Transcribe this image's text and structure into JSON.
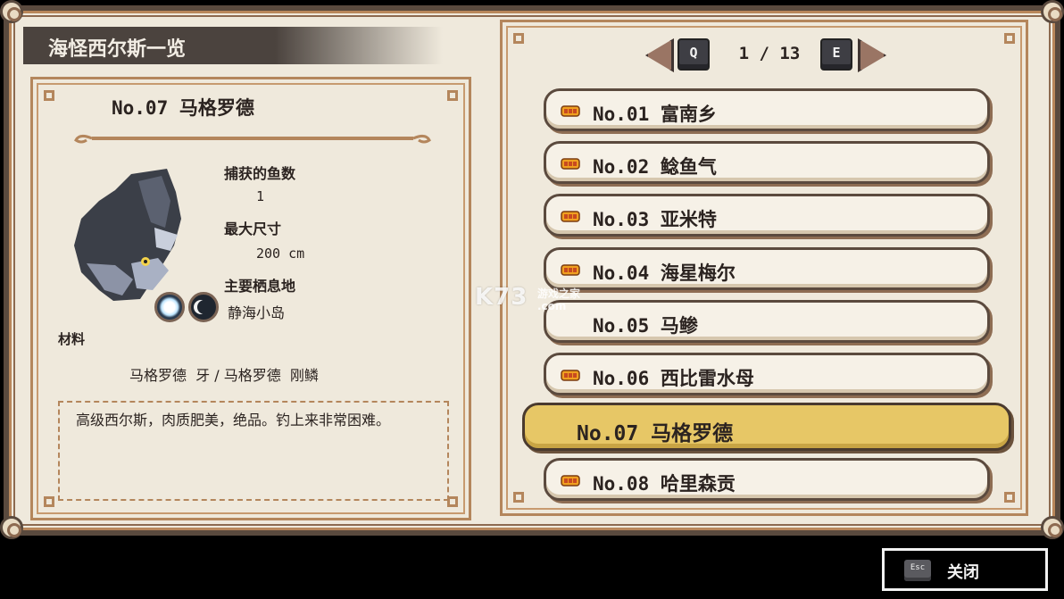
{
  "window": {
    "title": "海怪西尔斯一览"
  },
  "detail": {
    "name": "No.07 马格罗德",
    "caught_label": "捕获的鱼数",
    "caught_value": "1",
    "maxsize_label": "最大尺寸",
    "maxsize_value": "200 cm",
    "habitat_label": "主要栖息地",
    "habitat_value": "静海小岛",
    "habitat_icons": [
      "day-habitat-icon",
      "night-habitat-icon"
    ],
    "materials_label": "材料",
    "materials_value": "马格罗德  牙 / 马格罗德  刚鳞",
    "description": "高级西尔斯，肉质肥美，绝品。钓上来非常困难。"
  },
  "pager": {
    "prev_key": "Q",
    "next_key": "E",
    "current": "1 / 13"
  },
  "list": {
    "items": [
      {
        "label": "No.01 富南乡",
        "caught": true,
        "selected": false
      },
      {
        "label": "No.02 鲶鱼气",
        "caught": true,
        "selected": false
      },
      {
        "label": "No.03 亚米特",
        "caught": true,
        "selected": false
      },
      {
        "label": "No.04 海星梅尔",
        "caught": true,
        "selected": false
      },
      {
        "label": "No.05 马鲹",
        "caught": false,
        "selected": false
      },
      {
        "label": "No.06 西比雷水母",
        "caught": true,
        "selected": false
      },
      {
        "label": "No.07 马格罗德",
        "caught": false,
        "selected": true
      },
      {
        "label": "No.08 哈里森贡",
        "caught": true,
        "selected": false
      }
    ]
  },
  "footer": {
    "close_key": "Esc",
    "close_label": "关闭"
  },
  "watermark": {
    "big": "K73",
    "small": "游戏之家",
    "domain": ".com"
  },
  "colors": {
    "parchment": "#efe9dc",
    "frame_dark": "#5a4a3e",
    "frame_accent": "#b4865c",
    "selected_row": "#e7c766",
    "title_banner": "#4b433e"
  }
}
